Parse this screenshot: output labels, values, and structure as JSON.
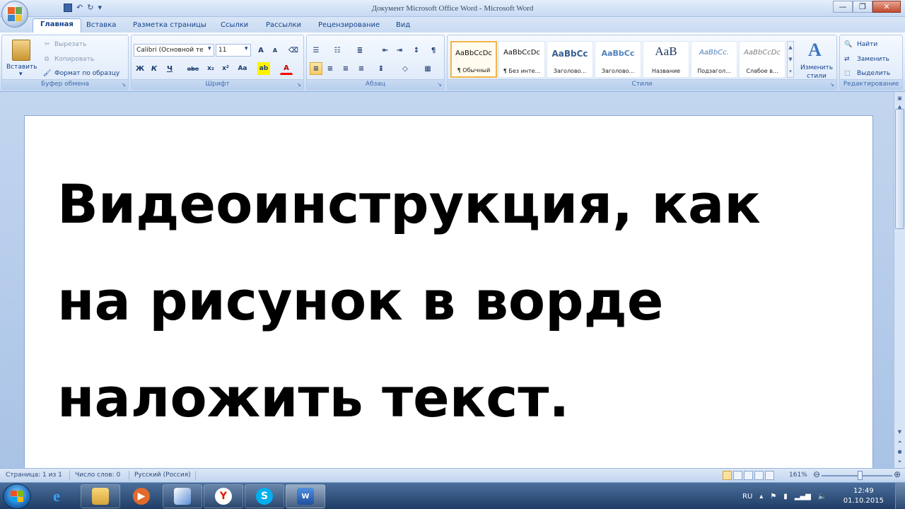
{
  "window": {
    "title": "Документ Microsoft Office Word - Microsoft Word"
  },
  "tabs": [
    "Главная",
    "Вставка",
    "Разметка страницы",
    "Ссылки",
    "Рассылки",
    "Рецензирование",
    "Вид"
  ],
  "clipboard": {
    "label": "Буфер обмена",
    "paste": "Вставить",
    "cut": "Вырезать",
    "copy": "Копировать",
    "format_painter": "Формат по образцу"
  },
  "font": {
    "label": "Шрифт",
    "family": "Calibri (Основной те",
    "size": "11",
    "bold": "Ж",
    "italic": "К",
    "underline": "Ч",
    "strike": "abe",
    "sub": "x₂",
    "sup": "x²",
    "case": "Aa"
  },
  "paragraph": {
    "label": "Абзац"
  },
  "styles": {
    "label": "Стили",
    "items": [
      {
        "sample": "AaBbCcDc",
        "name": "¶ Обычный"
      },
      {
        "sample": "AaBbCcDc",
        "name": "¶ Без инте..."
      },
      {
        "sample": "AaBbCc",
        "name": "Заголово..."
      },
      {
        "sample": "AaBbCc",
        "name": "Заголово..."
      },
      {
        "sample": "AaB",
        "name": "Название"
      },
      {
        "sample": "AaBbCc.",
        "name": "Подзагол..."
      },
      {
        "sample": "AaBbCcDc",
        "name": "Слабое в..."
      }
    ],
    "change": "Изменить стили"
  },
  "editing": {
    "label": "Редактирование",
    "find": "Найти",
    "replace": "Заменить",
    "select": "Выделить"
  },
  "document": {
    "text": "Видеоинструкция, как\nна рисунок в ворде\nналожить текст."
  },
  "status": {
    "page": "Страница: 1 из 1",
    "words": "Число слов: 0",
    "lang": "Русский (Россия)",
    "zoom": "161%"
  },
  "taskbar": {
    "lang": "RU",
    "time": "12:49",
    "date": "01.10.2015"
  },
  "colors": {
    "accent": "#15428b",
    "highlight": "#f8c964"
  }
}
